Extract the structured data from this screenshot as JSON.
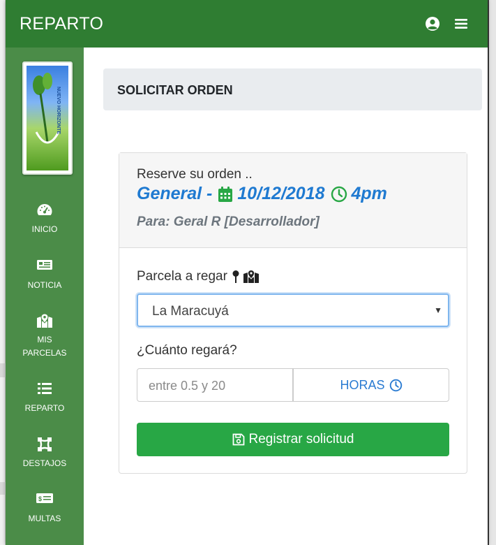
{
  "navbar": {
    "brand": "REPARTO",
    "color": "#2f7d32",
    "icons": [
      "user-circle-icon",
      "hamburger-menu-icon"
    ]
  },
  "sidebar": {
    "color": "#4b8c48",
    "logo_alt": "NUEVO HORIZONTE",
    "items": [
      {
        "icon": "speedometer-icon",
        "label": "INICIO"
      },
      {
        "icon": "newspaper-icon",
        "label": "NOTICIA"
      },
      {
        "icon": "map-marked-icon",
        "label": "MIS\nPARCELAS"
      },
      {
        "icon": "list-icon",
        "label": "REPARTO"
      },
      {
        "icon": "vector-square-icon",
        "label": "DESTAJOS"
      },
      {
        "icon": "money-bill-icon",
        "label": "MULTAS"
      }
    ]
  },
  "page": {
    "title": "SOLICITAR ORDEN"
  },
  "card": {
    "reserve_text": "Reserve su orden ..",
    "schedule_name": "General -",
    "date": "10/12/2018",
    "time": "4pm",
    "para": "Para: Geral R [Desarrollador]",
    "accent_color": "#1f7ad1",
    "icon_color": "#28a745"
  },
  "form": {
    "parcela_label": "Parcela a regar",
    "parcela_value": "La Maracuyá",
    "cuanto_label": "¿Cuánto regará?",
    "hours_placeholder": "entre 0.5 y 20",
    "horas_label": "HORAS",
    "submit_label": "Registrar solicitud"
  }
}
